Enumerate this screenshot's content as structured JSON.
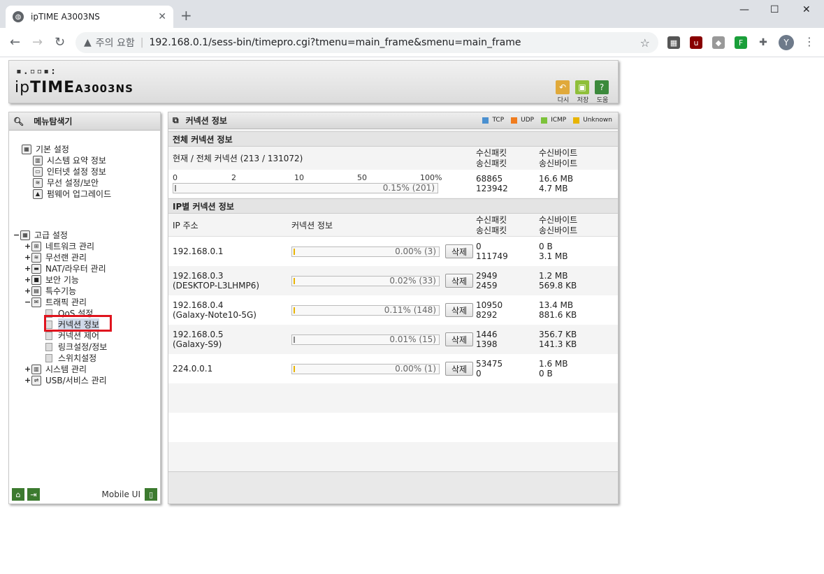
{
  "browser": {
    "tab_title": "ipTIME A3003NS",
    "security_label": "주의 요함",
    "url": "192.168.0.1/sess-bin/timepro.cgi?tmenu=main_frame&smenu=main_frame",
    "avatar_letter": "Y"
  },
  "header": {
    "logo_dots": "▪.▫▫▪:",
    "logo_ip": "ip",
    "logo_time": "TIME",
    "model": "A3003NS",
    "buttons": [
      {
        "label": "다시",
        "icon": "back-icon",
        "color": "#e0a93a"
      },
      {
        "label": "저장",
        "icon": "save-icon",
        "color": "#8fbf3a"
      },
      {
        "label": "도움",
        "icon": "help-icon",
        "color": "#3c8a3c"
      }
    ]
  },
  "sidebar": {
    "title": "메뉴탐색기",
    "basic": {
      "label": "기본 설정",
      "items": [
        "시스템 요약 정보",
        "인터넷 설정 정보",
        "무선 설정/보안",
        "펌웨어 업그레이드"
      ]
    },
    "advanced": {
      "label": "고급 설정",
      "items": [
        "네트워크 관리",
        "무선랜 관리",
        "NAT/라우터 관리",
        "보안 기능",
        "특수기능",
        "트래픽 관리"
      ],
      "traffic_sub": [
        "QoS 설정",
        "커넥션 정보",
        "커넥션 제어",
        "링크설정/정보",
        "스위치설정"
      ],
      "after": [
        "시스템 관리",
        "USB/서비스 관리"
      ]
    },
    "mobile_label": "Mobile UI"
  },
  "main": {
    "title": "커넥션 정보",
    "legend": [
      {
        "label": "TCP",
        "color": "#4a90d0"
      },
      {
        "label": "UDP",
        "color": "#f07c1e"
      },
      {
        "label": "ICMP",
        "color": "#7cc23a"
      },
      {
        "label": "Unknown",
        "color": "#e8b400"
      }
    ],
    "total_section": "전체 커넥션 정보",
    "current_total": "현재 / 전체 커넥션 (213 / 131072)",
    "col_rx_pkt": "수신패킷",
    "col_tx_pkt": "송신패킷",
    "col_rx_byte": "수신바이트",
    "col_tx_byte": "송신바이트",
    "scale": [
      "0",
      "2",
      "10",
      "50",
      "100%"
    ],
    "total_bar_text": "0.15% (201)",
    "total_bar_fraction": 0.0015,
    "total_rx_pkt": "68865",
    "total_tx_pkt": "123942",
    "total_rx_byte": "16.6 MB",
    "total_tx_byte": "4.7 MB",
    "ip_section": "IP별 커넥션 정보",
    "col_ip": "IP 주소",
    "col_conn": "커넥션 정보",
    "delete_label": "삭제",
    "rows": [
      {
        "ip": "192.168.0.1",
        "host": "",
        "bar": "0.00% (3)",
        "rx_pkt": "0",
        "tx_pkt": "111749",
        "rx_byte": "0 B",
        "tx_byte": "3.1 MB",
        "fill": "yellow"
      },
      {
        "ip": "192.168.0.3",
        "host": "(DESKTOP-L3LHMP6)",
        "bar": "0.02% (33)",
        "rx_pkt": "2949",
        "tx_pkt": "2459",
        "rx_byte": "1.2 MB",
        "tx_byte": "569.8 KB",
        "fill": "yellow"
      },
      {
        "ip": "192.168.0.4",
        "host": "(Galaxy-Note10-5G)",
        "bar": "0.11% (148)",
        "rx_pkt": "10950",
        "tx_pkt": "8292",
        "rx_byte": "13.4 MB",
        "tx_byte": "881.6 KB",
        "fill": "yellow"
      },
      {
        "ip": "192.168.0.5",
        "host": "(Galaxy-S9)",
        "bar": "0.01% (15)",
        "rx_pkt": "1446",
        "tx_pkt": "1398",
        "rx_byte": "356.7 KB",
        "tx_byte": "141.3 KB",
        "fill": "gray"
      },
      {
        "ip": "224.0.0.1",
        "host": "",
        "bar": "0.00% (1)",
        "rx_pkt": "53475",
        "tx_pkt": "0",
        "rx_byte": "1.6 MB",
        "tx_byte": "0 B",
        "fill": "yellow"
      }
    ]
  }
}
